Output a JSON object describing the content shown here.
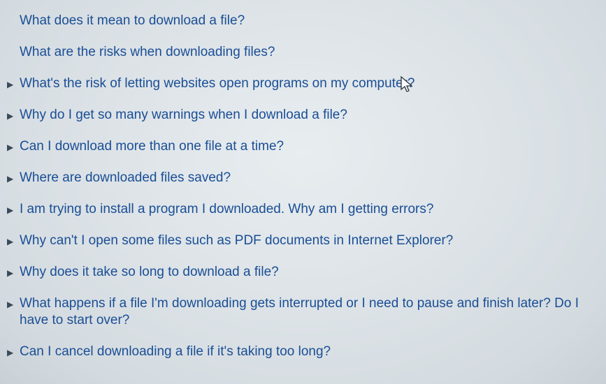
{
  "helpTopics": {
    "items": [
      {
        "question": "What does it mean to download a file?",
        "hasArrow": false
      },
      {
        "question": "What are the risks when downloading files?",
        "hasArrow": false
      },
      {
        "question": "What's the risk of letting websites open programs on my computer?",
        "hasArrow": true
      },
      {
        "question": "Why do I get so many warnings when I download a file?",
        "hasArrow": true
      },
      {
        "question": "Can I download more than one file at a time?",
        "hasArrow": true
      },
      {
        "question": "Where are downloaded files saved?",
        "hasArrow": true
      },
      {
        "question": "I am trying to install a program I downloaded. Why am I getting errors?",
        "hasArrow": true
      },
      {
        "question": "Why can't I open some files such as PDF documents in Internet Explorer?",
        "hasArrow": true
      },
      {
        "question": "Why does it take so long to download a file?",
        "hasArrow": true
      },
      {
        "question": "What happens if a file I'm downloading gets interrupted or I need to pause and finish later? Do I have to start over?",
        "hasArrow": true
      },
      {
        "question": "Can I cancel downloading a file if it's taking too long?",
        "hasArrow": true
      }
    ]
  }
}
